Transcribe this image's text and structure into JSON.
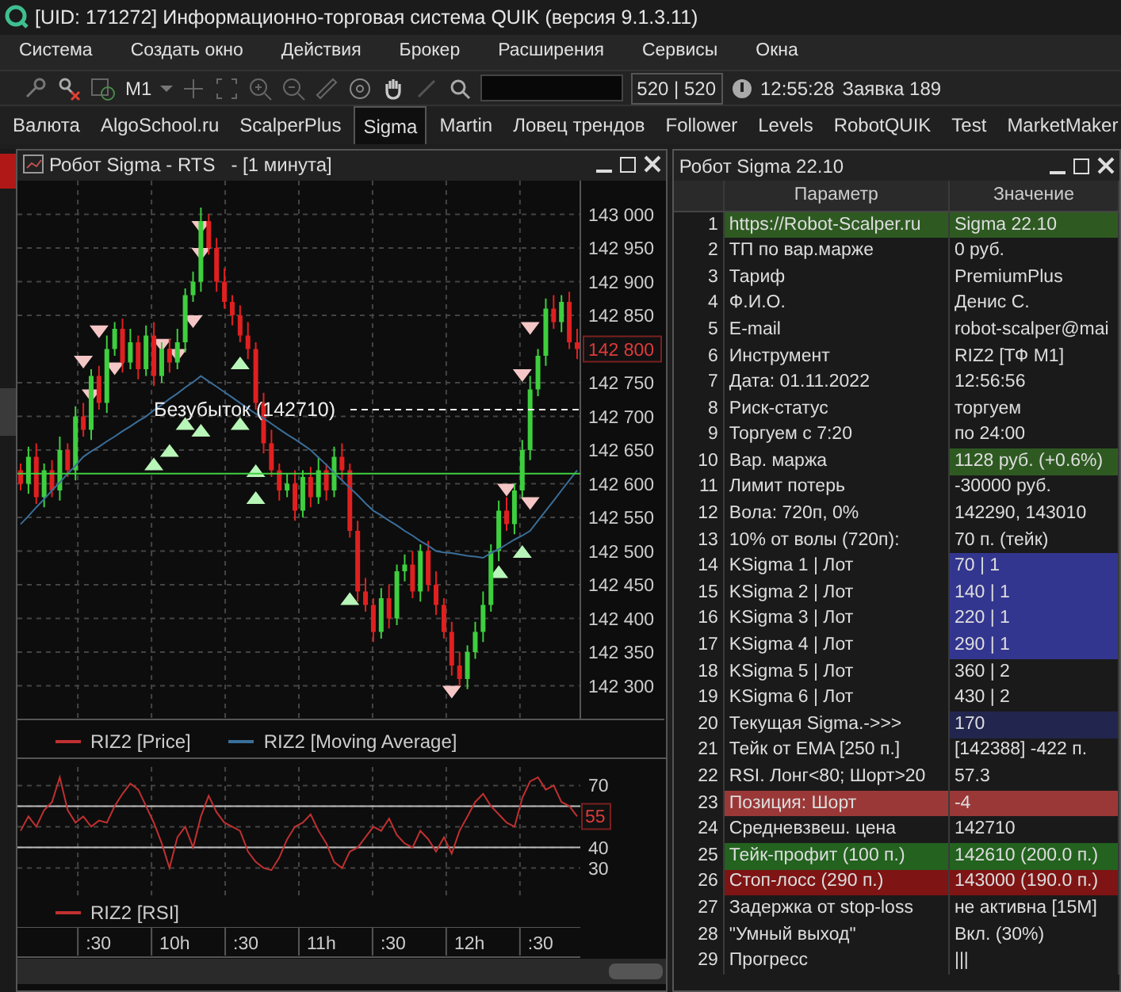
{
  "app": {
    "title": "[UID: 171272] Информационно-торговая система QUIK (версия 9.1.3.11)"
  },
  "menu": [
    "Система",
    "Создать окно",
    "Действия",
    "Брокер",
    "Расширения",
    "Сервисы",
    "Окна"
  ],
  "toolbar": {
    "interval": "M1",
    "counter": "520 | 520",
    "time": "12:55:28",
    "order": "Заявка 189"
  },
  "tabs": [
    {
      "label": "Валюта",
      "selected": false
    },
    {
      "label": "AlgoSchool.ru",
      "selected": false
    },
    {
      "label": "ScalperPlus",
      "selected": false
    },
    {
      "label": "Sigma",
      "selected": true
    },
    {
      "label": "Martin",
      "selected": false
    },
    {
      "label": "Ловец трендов",
      "selected": false
    },
    {
      "label": "Follower",
      "selected": false
    },
    {
      "label": "Levels",
      "selected": false
    },
    {
      "label": "RobotQUIK",
      "selected": false
    },
    {
      "label": "Test",
      "selected": false
    },
    {
      "label": "MarketMaker",
      "selected": false
    }
  ],
  "chart_window": {
    "title": "Робот Sigma - RTS   - [1 минута]",
    "price_chart": {
      "chart_data": {
        "type": "candlestick",
        "ylim": [
          142250,
          143050
        ],
        "grid": true,
        "ohlc": [
          [
            142620,
            142630,
            142590,
            142600
          ],
          [
            142600,
            142655,
            142585,
            142640
          ],
          [
            142640,
            142660,
            142570,
            142580
          ],
          [
            142580,
            142630,
            142565,
            142620
          ],
          [
            142620,
            142635,
            142580,
            142590
          ],
          [
            142590,
            142670,
            142575,
            142650
          ],
          [
            142650,
            142660,
            142610,
            142620
          ],
          [
            142620,
            142715,
            142605,
            142700
          ],
          [
            142700,
            142720,
            142670,
            142680
          ],
          [
            142680,
            142770,
            142665,
            142760
          ],
          [
            142760,
            142775,
            142710,
            142720
          ],
          [
            142720,
            142820,
            142705,
            142800
          ],
          [
            142800,
            142840,
            142790,
            142830
          ],
          [
            142830,
            142845,
            142765,
            142780
          ],
          [
            142780,
            142830,
            142770,
            142810
          ],
          [
            142810,
            142820,
            142755,
            142770
          ],
          [
            142770,
            142835,
            142760,
            142820
          ],
          [
            142820,
            142840,
            142745,
            142760
          ],
          [
            142760,
            142810,
            142750,
            142800
          ],
          [
            142800,
            142815,
            142765,
            142780
          ],
          [
            142780,
            142830,
            142770,
            142810
          ],
          [
            142810,
            142890,
            142795,
            142880
          ],
          [
            142880,
            142915,
            142870,
            142900
          ],
          [
            142900,
            143010,
            142885,
            142990
          ],
          [
            142990,
            143000,
            142940,
            142950
          ],
          [
            142950,
            142965,
            142885,
            142900
          ],
          [
            142900,
            142920,
            142860,
            142870
          ],
          [
            142870,
            142880,
            142835,
            142850
          ],
          [
            142850,
            142865,
            142810,
            142820
          ],
          [
            142820,
            142840,
            142785,
            142800
          ],
          [
            142800,
            142810,
            142710,
            142720
          ],
          [
            142720,
            142735,
            142645,
            142660
          ],
          [
            142660,
            142680,
            142610,
            142620
          ],
          [
            142620,
            142630,
            142575,
            142590
          ],
          [
            142590,
            142615,
            142580,
            142600
          ],
          [
            142600,
            142620,
            142545,
            142560
          ],
          [
            142560,
            142620,
            142550,
            142610
          ],
          [
            142610,
            142625,
            142565,
            142580
          ],
          [
            142580,
            142640,
            142570,
            142620
          ],
          [
            142620,
            142630,
            142575,
            142590
          ],
          [
            142590,
            142655,
            142580,
            142640
          ],
          [
            142640,
            142660,
            142605,
            142620
          ],
          [
            142620,
            142630,
            142520,
            142530
          ],
          [
            142530,
            142545,
            142425,
            142440
          ],
          [
            142440,
            142460,
            142410,
            142420
          ],
          [
            142420,
            142430,
            142365,
            142380
          ],
          [
            142380,
            142445,
            142370,
            142430
          ],
          [
            142430,
            142450,
            142385,
            142400
          ],
          [
            142400,
            142480,
            142390,
            142470
          ],
          [
            142470,
            142495,
            142455,
            142480
          ],
          [
            142480,
            142500,
            142430,
            142440
          ],
          [
            142440,
            142510,
            142425,
            142500
          ],
          [
            142500,
            142515,
            142440,
            142450
          ],
          [
            142450,
            142470,
            142405,
            142420
          ],
          [
            142420,
            142430,
            142370,
            142380
          ],
          [
            142380,
            142395,
            142315,
            142330
          ],
          [
            142330,
            142350,
            142300,
            142310
          ],
          [
            142310,
            142360,
            142295,
            142350
          ],
          [
            142350,
            142395,
            142340,
            142380
          ],
          [
            142380,
            142440,
            142365,
            142420
          ],
          [
            142420,
            142510,
            142410,
            142500
          ],
          [
            142500,
            142575,
            142485,
            142560
          ],
          [
            142560,
            142580,
            142530,
            142540
          ],
          [
            142540,
            142600,
            142525,
            142590
          ],
          [
            142590,
            142665,
            142580,
            142650
          ],
          [
            142650,
            142760,
            142635,
            142740
          ],
          [
            142740,
            142800,
            142730,
            142790
          ],
          [
            142790,
            142875,
            142775,
            142860
          ],
          [
            142860,
            142880,
            142830,
            142840
          ],
          [
            142840,
            142880,
            142825,
            142870
          ],
          [
            142870,
            142885,
            142800,
            142810
          ],
          [
            142810,
            142830,
            142785,
            142800
          ]
        ],
        "yticks": [
          {
            "value": 143000,
            "label": "143 000"
          },
          {
            "value": 142950,
            "label": "142 950"
          },
          {
            "value": 142900,
            "label": "142 900"
          },
          {
            "value": 142850,
            "label": "142 850"
          },
          {
            "value": 142750,
            "label": "142 750"
          },
          {
            "value": 142700,
            "label": "142 700"
          },
          {
            "value": 142650,
            "label": "142 650"
          },
          {
            "value": 142600,
            "label": "142 600"
          },
          {
            "value": 142550,
            "label": "142 550"
          },
          {
            "value": 142500,
            "label": "142 500"
          },
          {
            "value": 142450,
            "label": "142 450"
          },
          {
            "value": 142400,
            "label": "142 400"
          },
          {
            "value": 142350,
            "label": "142 350"
          },
          {
            "value": 142300,
            "label": "142 300"
          }
        ],
        "series": [
          {
            "name": "RIZ2 [Moving Average]",
            "type": "line",
            "color": "#3a6e9a",
            "values": [
              142540,
              142552,
              142565,
              142577,
              142590,
              142602,
              142615,
              142627,
              142640,
              142648,
              142655,
              142663,
              142670,
              142678,
              142685,
              142693,
              142700,
              142709,
              142717,
              142726,
              142734,
              142743,
              142751,
              142760,
              142752,
              142744,
              142736,
              142728,
              142720,
              142712,
              142704,
              142697,
              142689,
              142681,
              142673,
              142666,
              142658,
              142650,
              142639,
              142628,
              142616,
              142605,
              142594,
              142583,
              142571,
              142560,
              142553,
              142545,
              142538,
              142530,
              142523,
              142515,
              142508,
              142500,
              142498,
              142497,
              142495,
              142493,
              142492,
              142490,
              142497,
              142503,
              142510,
              142517,
              142523,
              142530,
              142545,
              142560,
              142575,
              142590,
              142605,
              142620
            ]
          }
        ],
        "ref_lines": [
          {
            "axis": "y",
            "value": 142710,
            "label": "Безубыток (142710)",
            "color": "#eeeeee"
          },
          {
            "axis": "y",
            "value": 142615,
            "color": "#40d040"
          }
        ]
      }
    },
    "price_legend": {
      "label": "RIZ2 [Price]",
      "color": "#c03030"
    },
    "current_price": "142 800",
    "rsi_chart": {
      "chart_data": {
        "type": "line",
        "ylim": [
          16,
          79
        ],
        "grid": true,
        "yticks": [
          {
            "value": 70,
            "label": "70"
          },
          {
            "value": 40,
            "label": "40"
          },
          {
            "value": 30,
            "label": "30"
          }
        ],
        "series": [
          {
            "name": "RIZ2 [RSI]",
            "color": "#c03030",
            "values": [
              48,
              55,
              50,
              58,
              62,
              74,
              58,
              52,
              55,
              50,
              53,
              52,
              60,
              66,
              71,
              68,
              60,
              52,
              42,
              30,
              45,
              50,
              40,
              55,
              65,
              57,
              52,
              50,
              48,
              38,
              33,
              30,
              29,
              35,
              44,
              50,
              52,
              56,
              48,
              42,
              33,
              30,
              38,
              40,
              45,
              50,
              48,
              54,
              46,
              42,
              40,
              48,
              44,
              38,
              45,
              37,
              48,
              55,
              62,
              66,
              60,
              56,
              52,
              50,
              64,
              72,
              74,
              68,
              70,
              62,
              60,
              55
            ]
          }
        ],
        "ref_lines": [
          {
            "axis": "y",
            "value": 60,
            "color": "#bbbbbb"
          },
          {
            "axis": "y",
            "value": 40,
            "color": "#bbbbbb"
          }
        ]
      }
    },
    "rsi_current": "55",
    "time_axis": [
      ":30",
      "10h",
      ":30",
      "11h",
      ":30",
      "12h",
      ":30"
    ]
  },
  "table_window": {
    "title": "Робот Sigma 22.10",
    "columns": [
      "Параметр",
      "Значение"
    ],
    "rows": [
      {
        "n": "1",
        "param": "https://Robot-Scalper.ru",
        "value": "Sigma 22.10",
        "param_lit": true,
        "value_lit": true,
        "color": "#2e5a22"
      },
      {
        "n": "2",
        "param": "ТП по вар.марже",
        "value": "0 руб.",
        "param_lit": false,
        "value_lit": false
      },
      {
        "n": "3",
        "param": "Тариф",
        "value": "PremiumPlus",
        "param_lit": false,
        "value_lit": false
      },
      {
        "n": "4",
        "param": "Ф.И.О.",
        "value": "Денис С.",
        "param_lit": false,
        "value_lit": false
      },
      {
        "n": "5",
        "param": "E-mail",
        "value": "robot-scalper@mai",
        "param_lit": false,
        "value_lit": false
      },
      {
        "n": "6",
        "param": "Инструмент",
        "value": "RIZ2  [ТФ M1]",
        "param_lit": false,
        "value_lit": false
      },
      {
        "n": "7",
        "param": "Дата: 01.11.2022",
        "value": "12:56:56",
        "param_lit": false,
        "value_lit": false
      },
      {
        "n": "8",
        "param": "Риск-статус",
        "value": "торгуем",
        "param_lit": false,
        "value_lit": false
      },
      {
        "n": "9",
        "param": "Торгуем с 7:20",
        "value": "по 24:00",
        "param_lit": false,
        "value_lit": false
      },
      {
        "n": "10",
        "param": "Вар. маржа",
        "value": "1128 руб. (+0.6%)",
        "param_lit": false,
        "value_lit": true,
        "color": "#2e5a22"
      },
      {
        "n": "11",
        "param": "Лимит потерь",
        "value": "-30000 руб.",
        "param_lit": false,
        "value_lit": false
      },
      {
        "n": "12",
        "param": "Вола: 720п, 0%",
        "value": "142290, 143010",
        "param_lit": false,
        "value_lit": false
      },
      {
        "n": "13",
        "param": "10% от волы (720п):",
        "value": "70 п. (тейк)",
        "param_lit": false,
        "value_lit": false
      },
      {
        "n": "14",
        "param": "KSigma 1 | Лот",
        "value": "70 | 1",
        "param_lit": false,
        "value_lit": true,
        "color": "#33368f"
      },
      {
        "n": "15",
        "param": "KSigma 2 | Лот",
        "value": "140 | 1",
        "param_lit": false,
        "value_lit": true,
        "color": "#33368f"
      },
      {
        "n": "16",
        "param": "KSigma 3 | Лот",
        "value": "220 | 1",
        "param_lit": false,
        "value_lit": true,
        "color": "#33368f"
      },
      {
        "n": "17",
        "param": "KSigma 4 | Лот",
        "value": "290 | 1",
        "param_lit": false,
        "value_lit": true,
        "color": "#33368f"
      },
      {
        "n": "18",
        "param": "KSigma 5 | Лот",
        "value": "360 | 2",
        "param_lit": false,
        "value_lit": false
      },
      {
        "n": "19",
        "param": "KSigma 6 | Лот",
        "value": "430 | 2",
        "param_lit": false,
        "value_lit": false
      },
      {
        "n": "20",
        "param": "Текущая Sigma.->>>",
        "value": "170",
        "param_lit": false,
        "value_lit": true,
        "color": "#22264e"
      },
      {
        "n": "21",
        "param": "Тейк от EMA [250 п.]",
        "value": "[142388] -422 п.",
        "param_lit": false,
        "value_lit": false
      },
      {
        "n": "22",
        "param": "RSI. Лонг<80; Шорт>20",
        "value": "57.3",
        "param_lit": false,
        "value_lit": false
      },
      {
        "n": "23",
        "param": "Позиция: Шорт",
        "value": "-4",
        "param_lit": true,
        "value_lit": true,
        "color": "#9a3838"
      },
      {
        "n": "24",
        "param": "Средневзвеш. цена",
        "value": "142710",
        "param_lit": false,
        "value_lit": false
      },
      {
        "n": "25",
        "param": "Тейк-профит (100 п.)",
        "value": "142610 (200.0 п.)",
        "param_lit": true,
        "value_lit": true,
        "color": "#23621f"
      },
      {
        "n": "26",
        "param": "Стоп-лосс (290 п.)",
        "value": "143000 (190.0 п.)",
        "param_lit": true,
        "value_lit": true,
        "color": "#7e1414"
      },
      {
        "n": "27",
        "param": "Задержка от stop-loss",
        "value": "не активна [15M]",
        "param_lit": false,
        "value_lit": false
      },
      {
        "n": "28",
        "param": "\"Умный выход\"",
        "value": "Вкл. (30%)",
        "param_lit": false,
        "value_lit": false
      },
      {
        "n": "29",
        "param": "Прогресс",
        "value": "|||",
        "param_lit": false,
        "value_lit": false
      }
    ]
  }
}
